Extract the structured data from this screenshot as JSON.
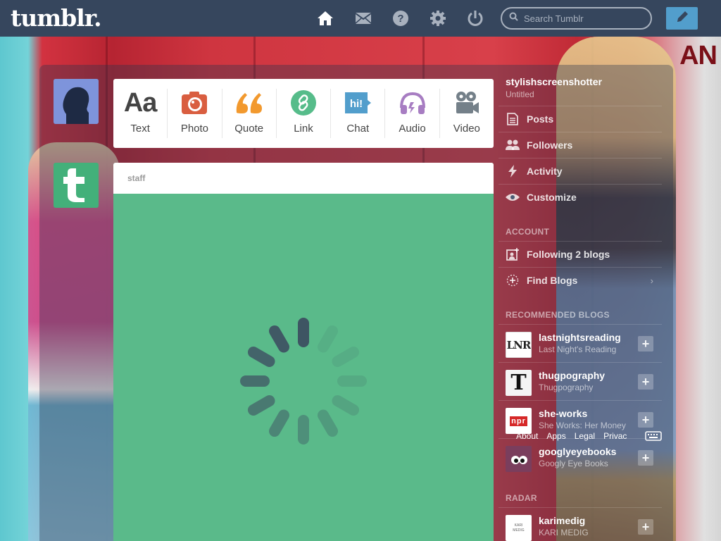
{
  "header": {
    "logo": "tumblr.",
    "search_placeholder": "Search Tumblr",
    "nav_icons": [
      "home-icon",
      "mail-icon",
      "help-icon",
      "gear-icon",
      "power-icon"
    ],
    "compose_icon": "pencil-icon"
  },
  "background": {
    "text": "AN"
  },
  "post_types": [
    {
      "label": "Text",
      "icon": "text-icon",
      "color": "#444444"
    },
    {
      "label": "Photo",
      "icon": "camera-icon",
      "color": "#d95e40"
    },
    {
      "label": "Quote",
      "icon": "quote-icon",
      "color": "#f2992e"
    },
    {
      "label": "Link",
      "icon": "link-icon",
      "color": "#56bc8a"
    },
    {
      "label": "Chat",
      "icon": "chat-icon",
      "color": "#529ecc"
    },
    {
      "label": "Audio",
      "icon": "headphones-icon",
      "color": "#a77dc2"
    },
    {
      "label": "Video",
      "icon": "video-camera-icon",
      "color": "#748089"
    }
  ],
  "post": {
    "author": "staff",
    "background": "#5aba8a"
  },
  "sidebar": {
    "blog_name": "stylishscreenshotter",
    "blog_title": "Untitled",
    "items": [
      {
        "label": "Posts",
        "icon": "posts-icon"
      },
      {
        "label": "Followers",
        "icon": "followers-icon"
      },
      {
        "label": "Activity",
        "icon": "lightning-icon"
      },
      {
        "label": "Customize",
        "icon": "eye-icon"
      }
    ],
    "account_head": "ACCOUNT",
    "account_items": [
      {
        "label": "Following 2 blogs",
        "icon": "following-icon"
      },
      {
        "label": "Find Blogs",
        "icon": "compass-icon",
        "chevron": "›"
      }
    ],
    "recommended_head": "RECOMMENDED BLOGS",
    "recommended": [
      {
        "name": "lastnightsreading",
        "sub": "Last Night's Reading",
        "thumb": "LNR"
      },
      {
        "name": "thugpography",
        "sub": "Thugpography",
        "thumb": "T"
      },
      {
        "name": "she-works",
        "sub": "She Works: Her Money",
        "thumb": "npr"
      },
      {
        "name": "googlyeyebooks",
        "sub": "Googly Eye Books",
        "thumb": ""
      }
    ],
    "radar_head": "RADAR",
    "radar": [
      {
        "name": "karimedig",
        "sub": "KARI MEDIG",
        "thumb": "KARI MEDIG"
      }
    ],
    "follow_symbol": "+"
  },
  "footer_links": [
    "About",
    "Apps",
    "Legal",
    "Privac"
  ]
}
